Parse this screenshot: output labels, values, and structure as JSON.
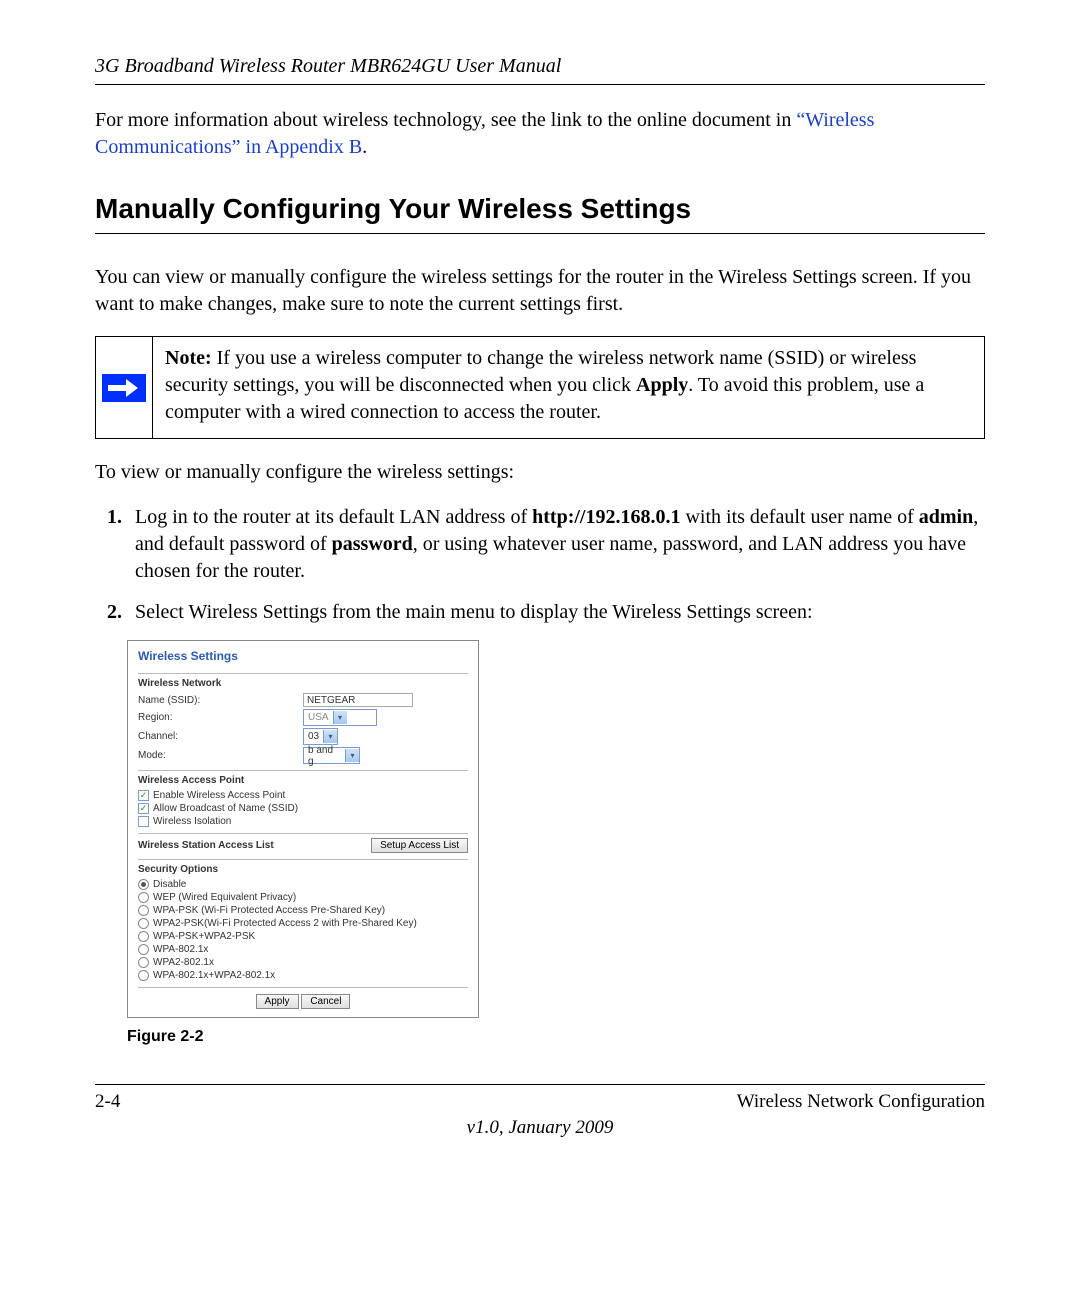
{
  "header": {
    "running_title": "3G Broadband Wireless Router MBR624GU User Manual"
  },
  "intro": {
    "prefix": "For more information about wireless technology, see the link to the online document in ",
    "link_text": "“Wireless Communications” in Appendix B",
    "suffix": "."
  },
  "section_title": "Manually Configuring Your Wireless Settings",
  "body_para": "You can view or manually configure the wireless settings for the router in the Wireless Settings screen. If you want to make changes, make sure to note the current settings first.",
  "note": {
    "label": "Note:",
    "text_1": " If you use a wireless computer to change the wireless network name (SSID) or wireless security settings, you will be disconnected when you click ",
    "bold_apply": "Apply",
    "text_2": ". To avoid this problem, use a computer with a wired connection to access the router."
  },
  "steps_intro": "To view or manually configure the wireless settings:",
  "steps": [
    {
      "pre": "Log in to the router at its default LAN address of ",
      "b1": "http://192.168.0.1",
      "mid1": " with its default user name of ",
      "b2": "admin",
      "mid2": ", and default password of ",
      "b3": "password",
      "post": ", or using whatever user name, password, and LAN address you have chosen for the router."
    },
    {
      "text": "Select Wireless Settings from the main menu to display the Wireless Settings screen:"
    }
  ],
  "screenshot": {
    "title": "Wireless Settings",
    "network_section": "Wireless Network",
    "name_label": "Name (SSID):",
    "name_value": "NETGEAR",
    "region_label": "Region:",
    "region_value": "USA",
    "channel_label": "Channel:",
    "channel_value": "03",
    "mode_label": "Mode:",
    "mode_value": "b and g",
    "ap_section": "Wireless Access Point",
    "cb_enable_ap": "Enable Wireless Access Point",
    "cb_broadcast": "Allow Broadcast of Name (SSID)",
    "cb_isolation": "Wireless Isolation",
    "station_section": "Wireless Station Access List",
    "btn_setup_access": "Setup Access List",
    "security_section": "Security Options",
    "radio_disable": "Disable",
    "radio_wep": "WEP (Wired Equivalent Privacy)",
    "radio_wpa_psk": "WPA-PSK (Wi-Fi Protected Access Pre-Shared Key)",
    "radio_wpa2_psk": "WPA2-PSK(Wi-Fi Protected Access 2 with Pre-Shared Key)",
    "radio_wpa_wpa2_psk": "WPA-PSK+WPA2-PSK",
    "radio_wpa_8021x": "WPA-802.1x",
    "radio_wpa2_8021x": "WPA2-802.1x",
    "radio_both_8021x": "WPA-802.1x+WPA2-802.1x",
    "btn_apply": "Apply",
    "btn_cancel": "Cancel"
  },
  "figure_label": "Figure 2-2",
  "footer": {
    "page_num": "2-4",
    "chapter": "Wireless Network Configuration",
    "version": "v1.0, January 2009"
  }
}
